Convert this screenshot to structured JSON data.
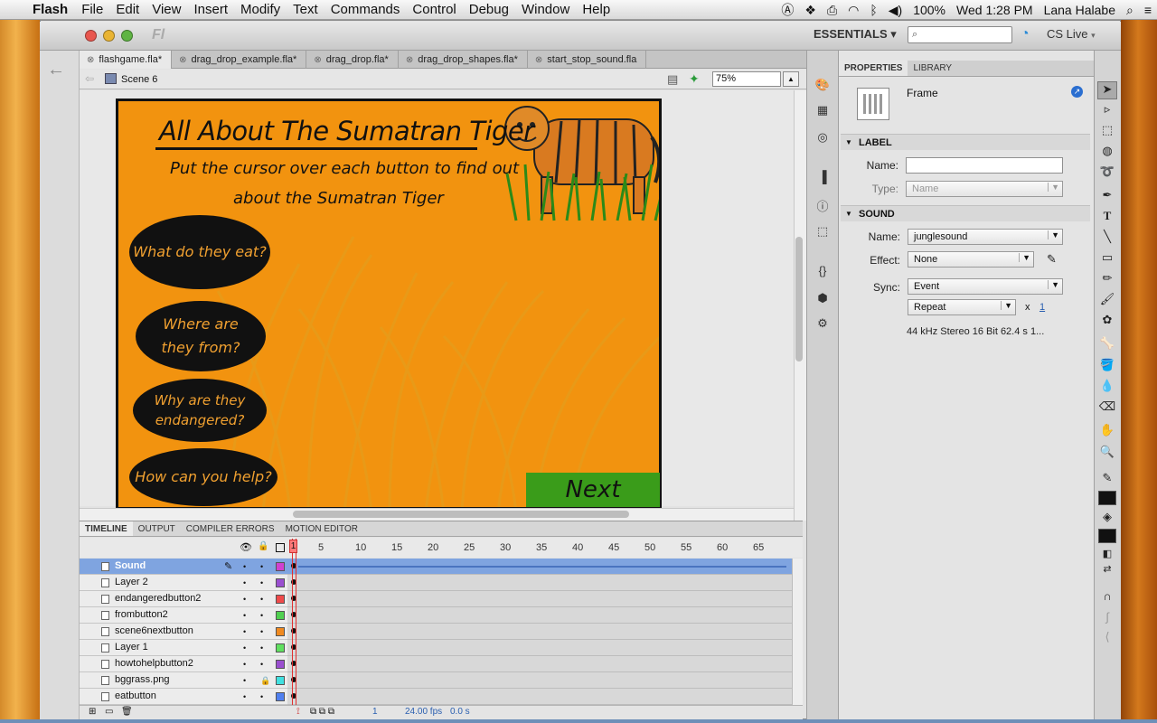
{
  "menubar": {
    "app": "Flash",
    "items": [
      "File",
      "Edit",
      "View",
      "Insert",
      "Modify",
      "Text",
      "Commands",
      "Control",
      "Debug",
      "Window",
      "Help"
    ],
    "battery": "100%",
    "clock": "Wed 1:28 PM",
    "user": "Lana Halabe"
  },
  "window": {
    "logo": "Fl",
    "workspace": "ESSENTIALS",
    "cs_live": "CS Live"
  },
  "doc_tabs": [
    "flashgame.fla*",
    "drag_drop_example.fla*",
    "drag_drop.fla*",
    "drag_drop_shapes.fla*",
    "start_stop_sound.fla"
  ],
  "scene": {
    "label": "Scene 6",
    "zoom": "75%"
  },
  "stage": {
    "title": "All About The Sumatran Tiger",
    "subtitle_line1": "Put the cursor over each button to find out",
    "subtitle_line2": "about the Sumatran Tiger",
    "buttons": [
      {
        "line1": "What do they eat?",
        "line2": ""
      },
      {
        "line1": "Where are",
        "line2": "they from?"
      },
      {
        "line1": "Why are they",
        "line2": "endangered?"
      },
      {
        "line1": "How can you help?",
        "line2": ""
      }
    ],
    "next": "Next",
    "bg_color": "#f2930f",
    "button_color": "#111111",
    "next_color": "#3a9c1a"
  },
  "timeline": {
    "tabs": [
      "TIMELINE",
      "OUTPUT",
      "COMPILER ERRORS",
      "MOTION EDITOR"
    ],
    "frame_numbers": [
      "1",
      "5",
      "10",
      "15",
      "20",
      "25",
      "30",
      "35",
      "40",
      "45",
      "50",
      "55",
      "60",
      "65"
    ],
    "layers": [
      {
        "name": "Sound",
        "color": "#d040d0",
        "selected": true
      },
      {
        "name": "Layer 2",
        "color": "#9a4fd0"
      },
      {
        "name": "endangeredbutton2",
        "color": "#f04a4a"
      },
      {
        "name": "frombutton2",
        "color": "#50d050"
      },
      {
        "name": "scene6nextbutton",
        "color": "#f08a20"
      },
      {
        "name": "Layer 1",
        "color": "#60e060"
      },
      {
        "name": "howtohelpbutton2",
        "color": "#9a4fd0"
      },
      {
        "name": "bggrass.png",
        "color": "#40e0e0"
      },
      {
        "name": "eatbutton",
        "color": "#5080f0"
      }
    ],
    "footer": {
      "frame": "1",
      "fps": "24.00 fps",
      "time": "0.0 s"
    }
  },
  "properties": {
    "tabs": [
      "PROPERTIES",
      "LIBRARY"
    ],
    "object": "Frame",
    "label_section": "LABEL",
    "name_label": "Name:",
    "name_value": "",
    "type_label": "Type:",
    "type_value": "Name",
    "sound_section": "SOUND",
    "sound_name_label": "Name:",
    "sound_name": "junglesound",
    "effect_label": "Effect:",
    "effect": "None",
    "sync_label": "Sync:",
    "sync": "Event",
    "repeat": "Repeat",
    "repeat_x": "x",
    "repeat_count": "1",
    "sound_info": "44 kHz Stereo 16 Bit 62.4 s 1..."
  },
  "icons": [
    "apple-icon",
    "search-icon",
    "wifi-icon",
    "bluetooth-icon",
    "volume-icon",
    "tiger-image",
    "pencil-icon",
    "lock-icon",
    "eye-icon"
  ]
}
